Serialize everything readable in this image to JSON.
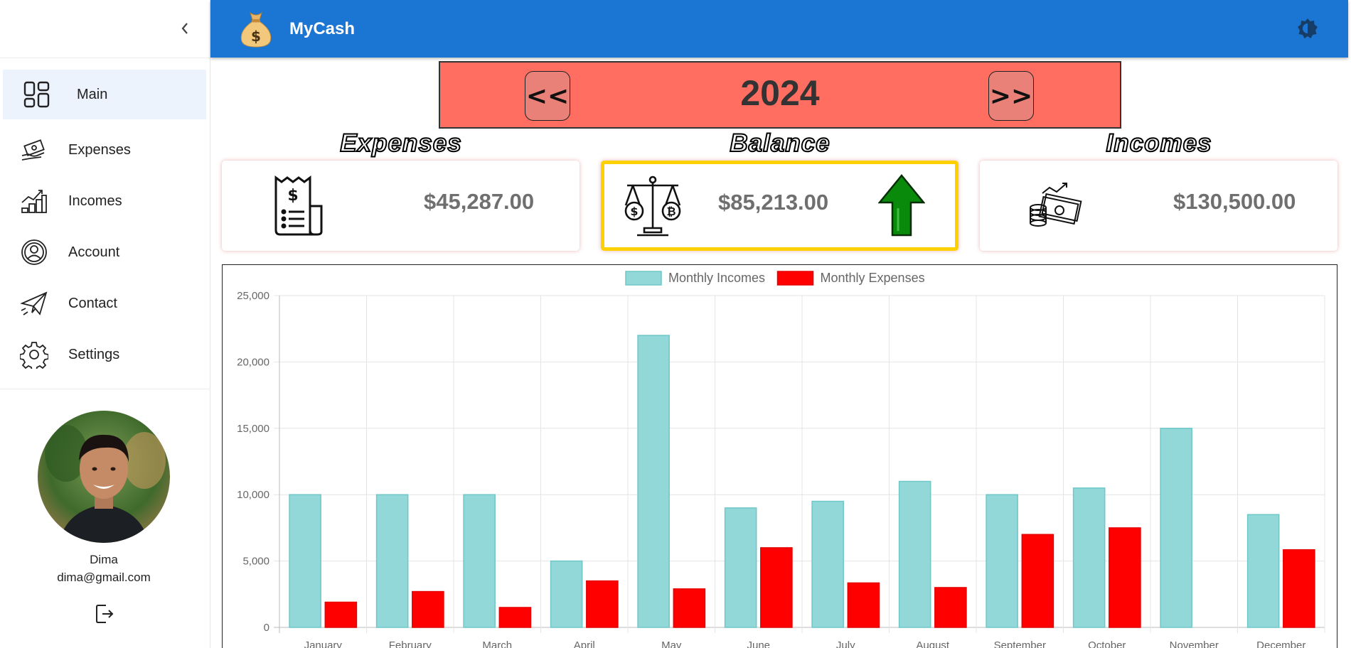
{
  "sidebar": {
    "items": [
      {
        "label": "Main",
        "active": true
      },
      {
        "label": "Expenses"
      },
      {
        "label": "Incomes"
      },
      {
        "label": "Account"
      },
      {
        "label": "Contact"
      },
      {
        "label": "Settings"
      }
    ],
    "user": {
      "name": "Dima",
      "email": "dima@gmail.com"
    }
  },
  "header": {
    "title": "MyCash"
  },
  "year_nav": {
    "prev_label": "<<",
    "year": "2024",
    "next_label": ">>"
  },
  "summary": {
    "expenses": {
      "title": "Expenses",
      "amount": "$45,287.00"
    },
    "balance": {
      "title": "Balance",
      "amount": "$85,213.00",
      "trend": "up"
    },
    "incomes": {
      "title": "Incomes",
      "amount": "$130,500.00"
    }
  },
  "colors": {
    "header": "#1a76d2",
    "year_bar": "#ff6e60",
    "balance_border": "#fdd000",
    "income_bar": "#93d8d9",
    "expense_bar": "#ff0000",
    "arrow": "#0a8a0a"
  },
  "chart_data": {
    "type": "bar",
    "categories": [
      "January",
      "February",
      "March",
      "April",
      "May",
      "June",
      "July",
      "August",
      "September",
      "October",
      "November",
      "December"
    ],
    "series": [
      {
        "name": "Monthly Incomes",
        "values": [
          10000,
          10000,
          10000,
          5000,
          22000,
          9000,
          9500,
          11000,
          10000,
          10500,
          15000,
          8500
        ]
      },
      {
        "name": "Monthly Expenses",
        "values": [
          1900,
          2700,
          1500,
          3500,
          2900,
          6000,
          3350,
          3000,
          7000,
          7500,
          0,
          5850
        ]
      }
    ],
    "yticks": [
      "0",
      "5,000",
      "10,000",
      "15,000",
      "20,000",
      "25,000"
    ],
    "ylim": [
      0,
      25000
    ],
    "grid": true,
    "legend": "top-center"
  }
}
